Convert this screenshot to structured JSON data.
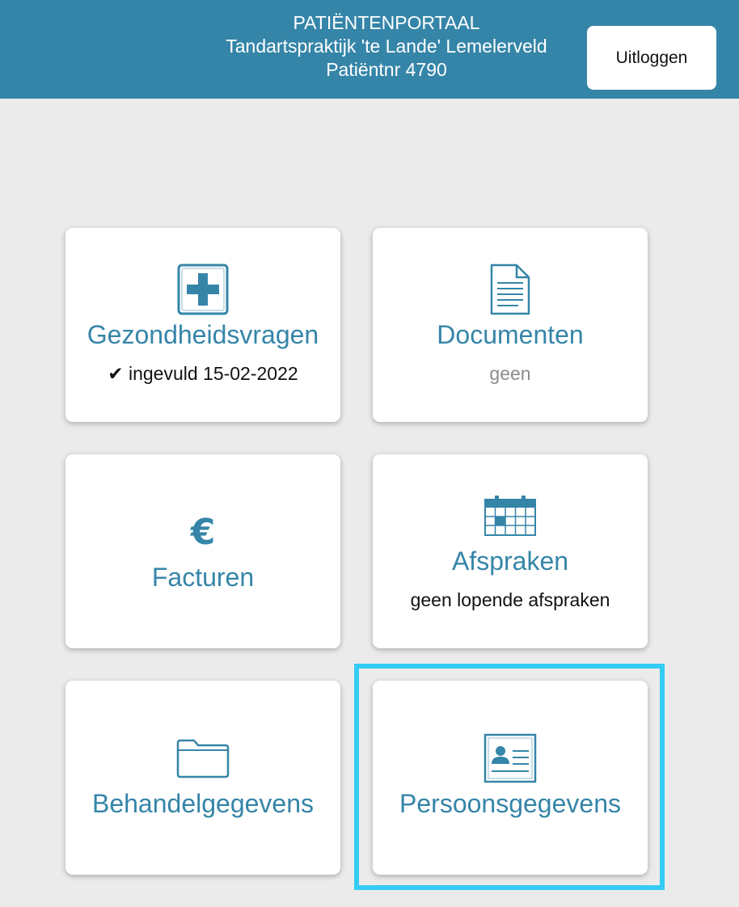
{
  "header": {
    "portal_title": "PATIËNTENPORTAAL",
    "practice_name": "Tandartspraktijk 'te Lande' Lemelerveld",
    "patient_number": "Patiëntnr 4790",
    "logout_label": "Uitloggen"
  },
  "tiles": {
    "health": {
      "title": "Gezondheidsvragen",
      "status": "✔ ingevuld 15-02-2022",
      "icon": "medical-cross-icon"
    },
    "documents": {
      "title": "Documenten",
      "status": "geen",
      "icon": "document-icon"
    },
    "invoices": {
      "title": "Facturen",
      "icon": "euro-icon",
      "icon_glyph": "€"
    },
    "appointments": {
      "title": "Afspraken",
      "status": "geen lopende afspraken",
      "icon": "calendar-icon"
    },
    "treatment": {
      "title": "Behandelgegevens",
      "icon": "folder-icon"
    },
    "personal": {
      "title": "Persoonsgegevens",
      "icon": "id-card-icon"
    }
  },
  "colors": {
    "accent": "#3585a8",
    "background": "#ebebeb",
    "highlight": "#35ccf4",
    "muted_text": "#8c8c8c"
  }
}
